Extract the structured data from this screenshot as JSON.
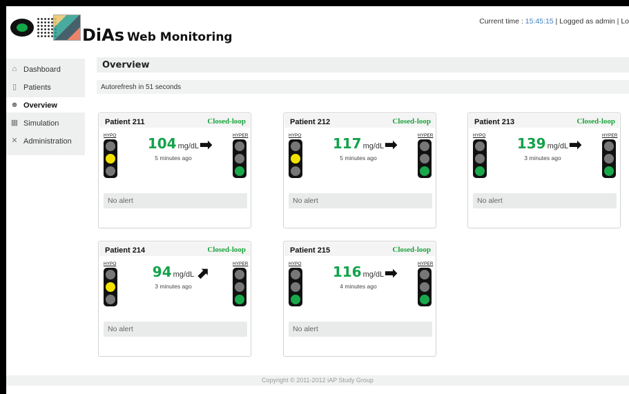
{
  "header": {
    "app_name_a": "DiAs",
    "app_name_b": "Web Monitoring",
    "time_label": "Current time : ",
    "time_value": "15:45:15",
    "user_label": " | Logged as admin | ",
    "logout_label": "Lo"
  },
  "sidebar": {
    "items": [
      {
        "label": "Dashboard",
        "icon": "home-icon"
      },
      {
        "label": "Patients",
        "icon": "clipboard-icon"
      },
      {
        "label": "Overview",
        "icon": "people-icon",
        "active": true
      },
      {
        "label": "Simulation",
        "icon": "table-icon"
      },
      {
        "label": "Administration",
        "icon": "tools-icon"
      }
    ]
  },
  "main": {
    "title": "Overview",
    "autorefresh": "Autorefresh in 51 seconds"
  },
  "labels": {
    "hypo": "HYPO",
    "hyper": "HYPER",
    "unit": "mg/dL"
  },
  "patients": [
    {
      "name": "Patient 211",
      "mode": "Closed-loop",
      "value": "104",
      "ago": "5 minutes ago",
      "arrow": "right",
      "alert": "No alert",
      "hypo_light": "yellow",
      "hyper_light": "green"
    },
    {
      "name": "Patient 212",
      "mode": "Closed-loop",
      "value": "117",
      "ago": "5 minutes ago",
      "arrow": "right",
      "alert": "No alert",
      "hypo_light": "yellow",
      "hyper_light": "green"
    },
    {
      "name": "Patient 213",
      "mode": "Closed-loop",
      "value": "139",
      "ago": "3 minutes ago",
      "arrow": "right",
      "alert": "No alert",
      "hypo_light": "green",
      "hyper_light": "green"
    },
    {
      "name": "Patient 214",
      "mode": "Closed-loop",
      "value": "94",
      "ago": "3 minutes ago",
      "arrow": "up-right",
      "alert": "No alert",
      "hypo_light": "yellow",
      "hyper_light": "green"
    },
    {
      "name": "Patient 215",
      "mode": "Closed-loop",
      "value": "116",
      "ago": "4 minutes ago",
      "arrow": "right",
      "alert": "No alert",
      "hypo_light": "green",
      "hyper_light": "green"
    }
  ],
  "colors": {
    "value_green": "#14a24a",
    "mode_green": "#1aa33c",
    "light_yellow": "#f2e200",
    "light_green": "#19a84b",
    "time_blue": "#3a7cc0"
  },
  "footer": {
    "copyright": "Copyright © 2011-2012 iAP Study Group"
  }
}
